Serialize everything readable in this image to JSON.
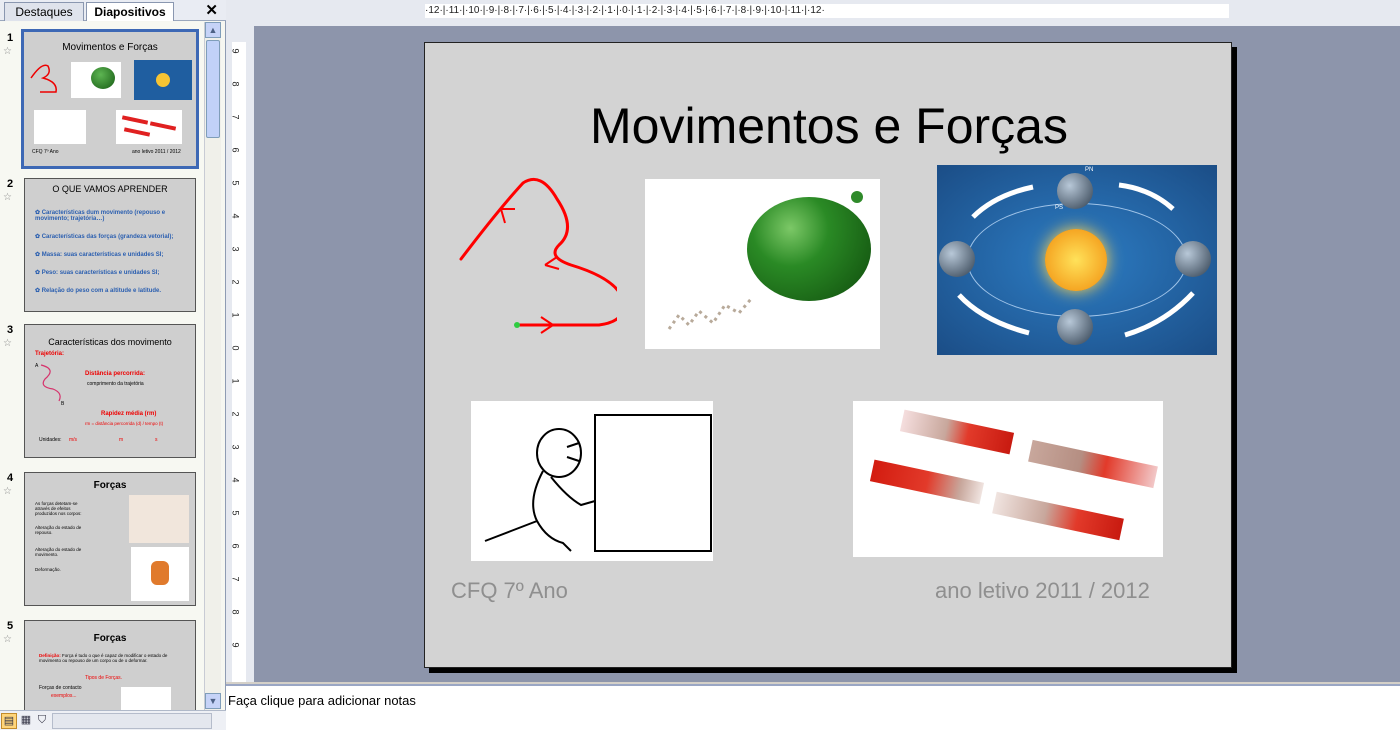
{
  "panel": {
    "tabs": [
      "Destaques",
      "Diapositivos"
    ],
    "close_glyph": "✕"
  },
  "thumbnails": [
    {
      "num": "1",
      "title": "Movimentos e Forças",
      "footer_left": "CFQ 7º Ano",
      "footer_right": "ano letivo 2011 / 2012"
    },
    {
      "num": "2",
      "title": "O QUE VAMOS APRENDER",
      "items": [
        "Características dum movimento (repouso e movimento; trajetória…)",
        "Características das forças (grandeza vetorial);",
        "Massa: suas características e unidades SI;",
        "Peso: suas características e unidades SI;",
        "Relação do peso com a altitude e latitude."
      ]
    },
    {
      "num": "3",
      "title": "Características dos movimento",
      "trajectory_label": "Trajetória:",
      "point_a": "A",
      "point_b": "B",
      "distance_label": "Distância percorrida:",
      "distance_desc": "comprimento da trajetória",
      "speed_label": "Rapidez média (rm)",
      "speed_formula": "rm = distância percorrida (d) / tempo (t)",
      "units_label": "Unidades:",
      "unit_a": "m/s",
      "unit_b": "m",
      "unit_c": "s"
    },
    {
      "num": "4",
      "title": "Forças",
      "items": [
        "As forças detetam-se através de efeitos produzidos nos corpos:",
        "Alteração do estado de repouso.",
        "Alteração do estado de movimento.",
        "Deformação."
      ]
    },
    {
      "num": "5",
      "title": "Forças",
      "definition_label": "Definição:",
      "definition_text": "Força é tudo o que é capaz de modificar o estado de movimento ou repouso de um corpo ou de o deformar.",
      "types_label": "Tipos de Forças.",
      "contact_label": "Forças de contacto",
      "examples_label": "exemplos..."
    }
  ],
  "ruler": {
    "h": "·12·|·11·|·10·|·9·|·8·|·7·|·6·|·5·|·4·|·3·|·2·|·1·|·0·|·1·|·2·|·3·|·4·|·5·|·6·|·7·|·8·|·9·|·10·|·11·|·12·",
    "v": [
      "9",
      "8",
      "7",
      "6",
      "5",
      "4",
      "3",
      "2",
      "1",
      "0",
      "1",
      "2",
      "3",
      "4",
      "5",
      "6",
      "7",
      "8",
      "9"
    ]
  },
  "slide": {
    "title": "Movimentos e Forças",
    "footer_left": "CFQ 7º Ano",
    "footer_right": "ano letivo 2011 / 2012",
    "images": [
      "trajectory-image",
      "balloon-image",
      "earth-orbit-image",
      "pushing-box-image",
      "magnets-image"
    ],
    "orbit_labels": [
      "PN",
      "PS"
    ]
  },
  "notes": {
    "placeholder": "Faça clique para adicionar notas"
  },
  "colors": {
    "slide_bg": "#d3d3d3",
    "stage_bg": "#8d95ab",
    "selected_border": "#3d68b5",
    "title_red": "#e00000",
    "bullet_blue": "#2b5fb0"
  }
}
